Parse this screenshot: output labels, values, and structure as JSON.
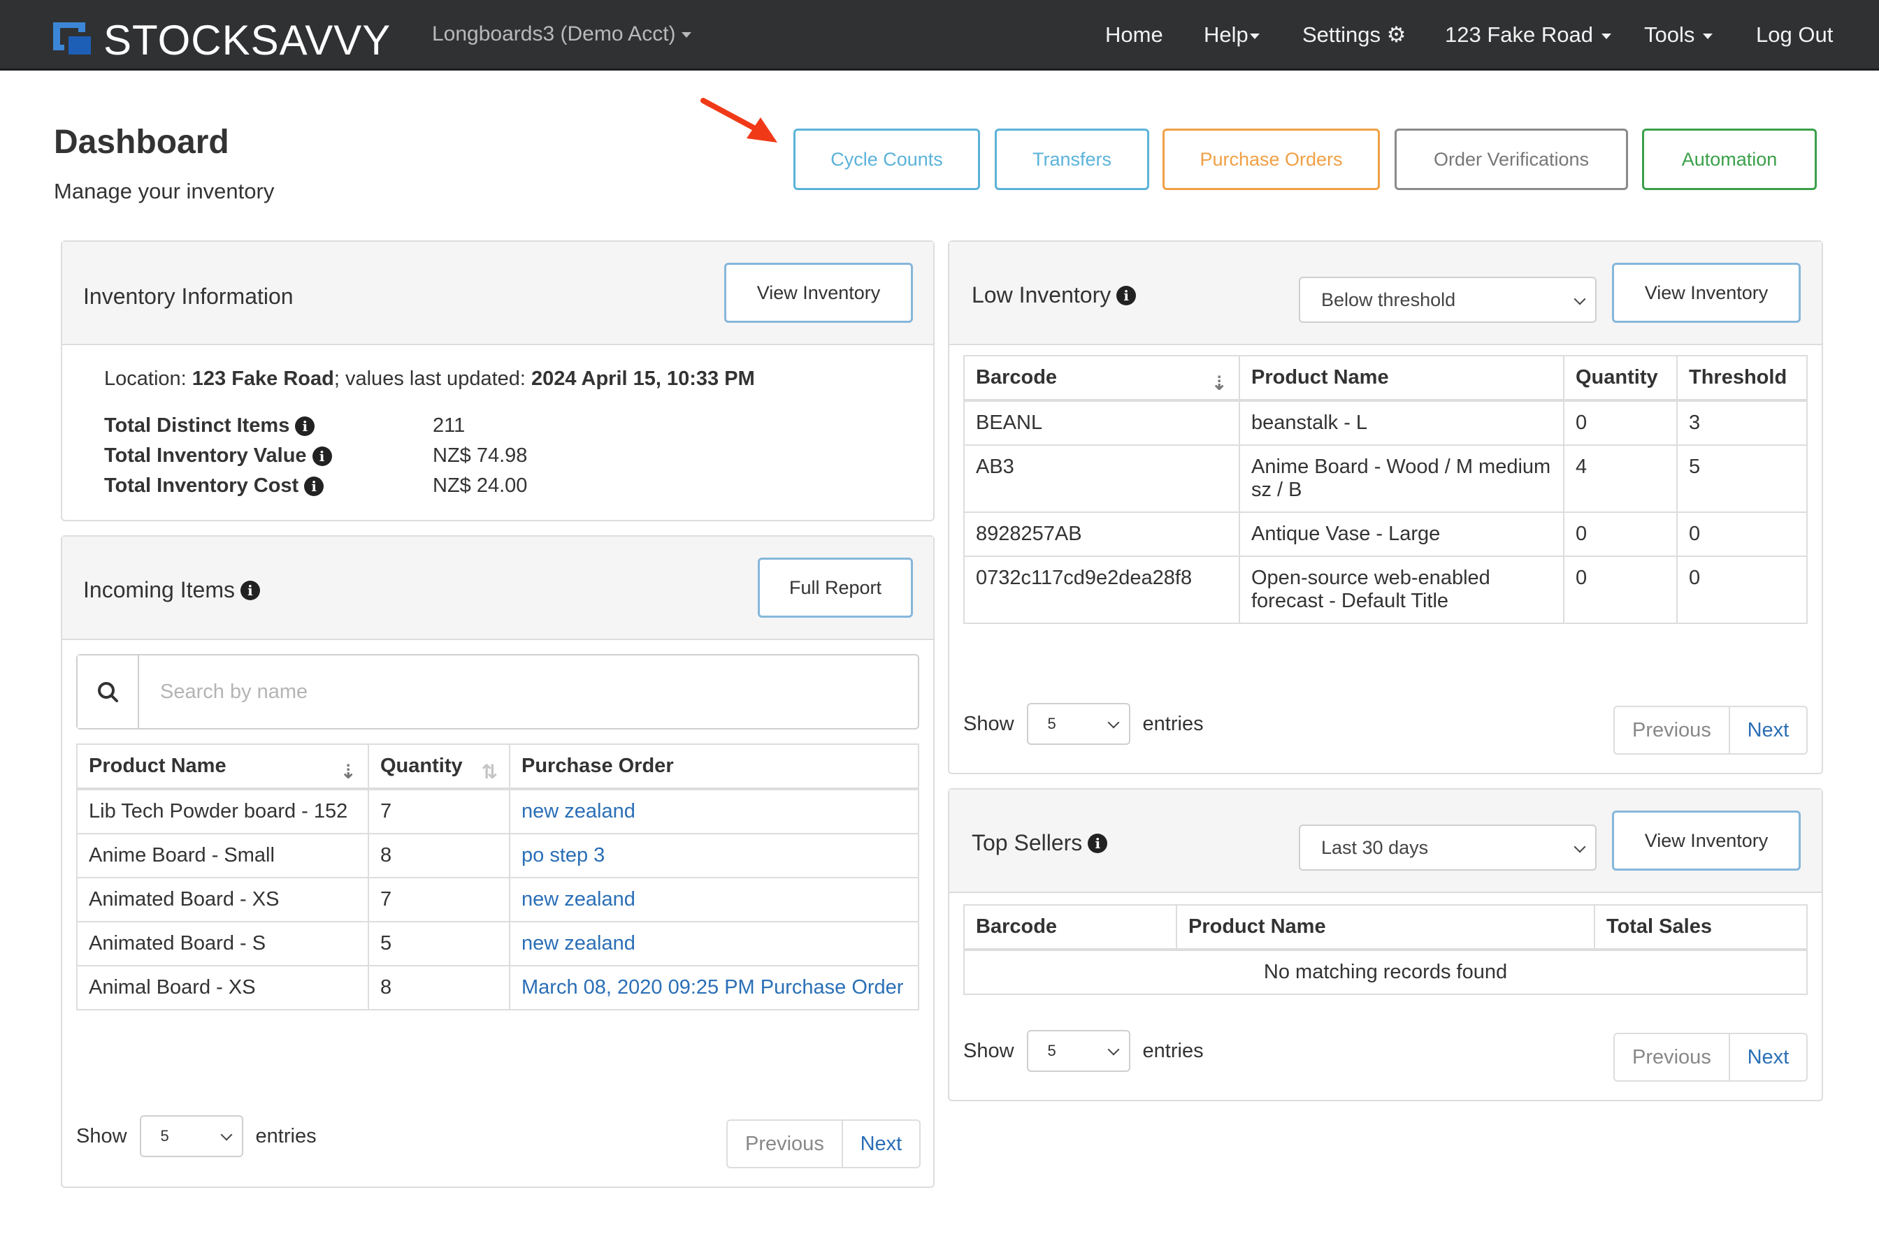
{
  "navbar": {
    "brand": "STOCKSAVVY",
    "account": "Longboards3 (Demo Acct)",
    "items": {
      "home": "Home",
      "help": "Help",
      "settings": "Settings",
      "location": "123 Fake Road",
      "tools": "Tools",
      "logout": "Log Out"
    }
  },
  "header": {
    "title": "Dashboard",
    "subtitle": "Manage your inventory",
    "buttons": {
      "cycle_counts": "Cycle Counts",
      "transfers": "Transfers",
      "purchase_orders": "Purchase Orders",
      "order_verifications": "Order Verifications",
      "automation": "Automation"
    },
    "colors": {
      "cycle_counts": "#5bb3d9",
      "transfers": "#5bb3d9",
      "purchase_orders": "#f0a046",
      "order_verifications": "#8a8a8a",
      "automation": "#3aa04a",
      "arrow": "#f03a17"
    }
  },
  "inventory_info": {
    "title": "Inventory Information",
    "button": "View Inventory",
    "location_prefix": "Location: ",
    "location": "123 Fake Road",
    "updated_prefix": "; values last updated: ",
    "updated": "2024 April 15, 10:33 PM",
    "stats": [
      {
        "label": "Total Distinct Items",
        "value": "211"
      },
      {
        "label": "Total Inventory Value",
        "value": "NZ$ 74.98"
      },
      {
        "label": "Total Inventory Cost",
        "value": "NZ$ 24.00"
      }
    ]
  },
  "incoming": {
    "title": "Incoming Items",
    "button": "Full Report",
    "search_placeholder": "Search by name",
    "columns": [
      "Product Name",
      "Quantity",
      "Purchase Order"
    ],
    "rows": [
      {
        "product": "Lib Tech Powder board - 152",
        "qty": "7",
        "po": "new zealand"
      },
      {
        "product": "Anime Board - Small",
        "qty": "8",
        "po": "po step 3"
      },
      {
        "product": "Animated Board - XS",
        "qty": "7",
        "po": "new zealand"
      },
      {
        "product": "Animated Board - S",
        "qty": "5",
        "po": "new zealand"
      },
      {
        "product": "Animal Board - XS",
        "qty": "8",
        "po": "March 08, 2020 09:25 PM Purchase Order"
      }
    ],
    "show": "Show",
    "length": "5",
    "entries": "entries",
    "previous": "Previous",
    "next": "Next"
  },
  "low_inventory": {
    "title": "Low Inventory",
    "filter": "Below threshold",
    "button": "View Inventory",
    "columns": [
      "Barcode",
      "Product Name",
      "Quantity",
      "Threshold"
    ],
    "rows": [
      {
        "barcode": "BEANL",
        "product": "beanstalk - L",
        "qty": "0",
        "threshold": "3"
      },
      {
        "barcode": "AB3",
        "product": "Anime Board - Wood / M medium sz / B",
        "qty": "4",
        "threshold": "5"
      },
      {
        "barcode": "8928257AB",
        "product": "Antique Vase - Large",
        "qty": "0",
        "threshold": "0"
      },
      {
        "barcode": "0732c117cd9e2dea28f8",
        "product": "Open-source web-enabled forecast - Default Title",
        "qty": "0",
        "threshold": "0"
      }
    ],
    "show": "Show",
    "length": "5",
    "entries": "entries",
    "previous": "Previous",
    "next": "Next"
  },
  "top_sellers": {
    "title": "Top Sellers",
    "filter": "Last 30 days",
    "button": "View Inventory",
    "columns": [
      "Barcode",
      "Product Name",
      "Total Sales"
    ],
    "empty": "No matching records found",
    "show": "Show",
    "length": "5",
    "entries": "entries",
    "previous": "Previous",
    "next": "Next"
  }
}
